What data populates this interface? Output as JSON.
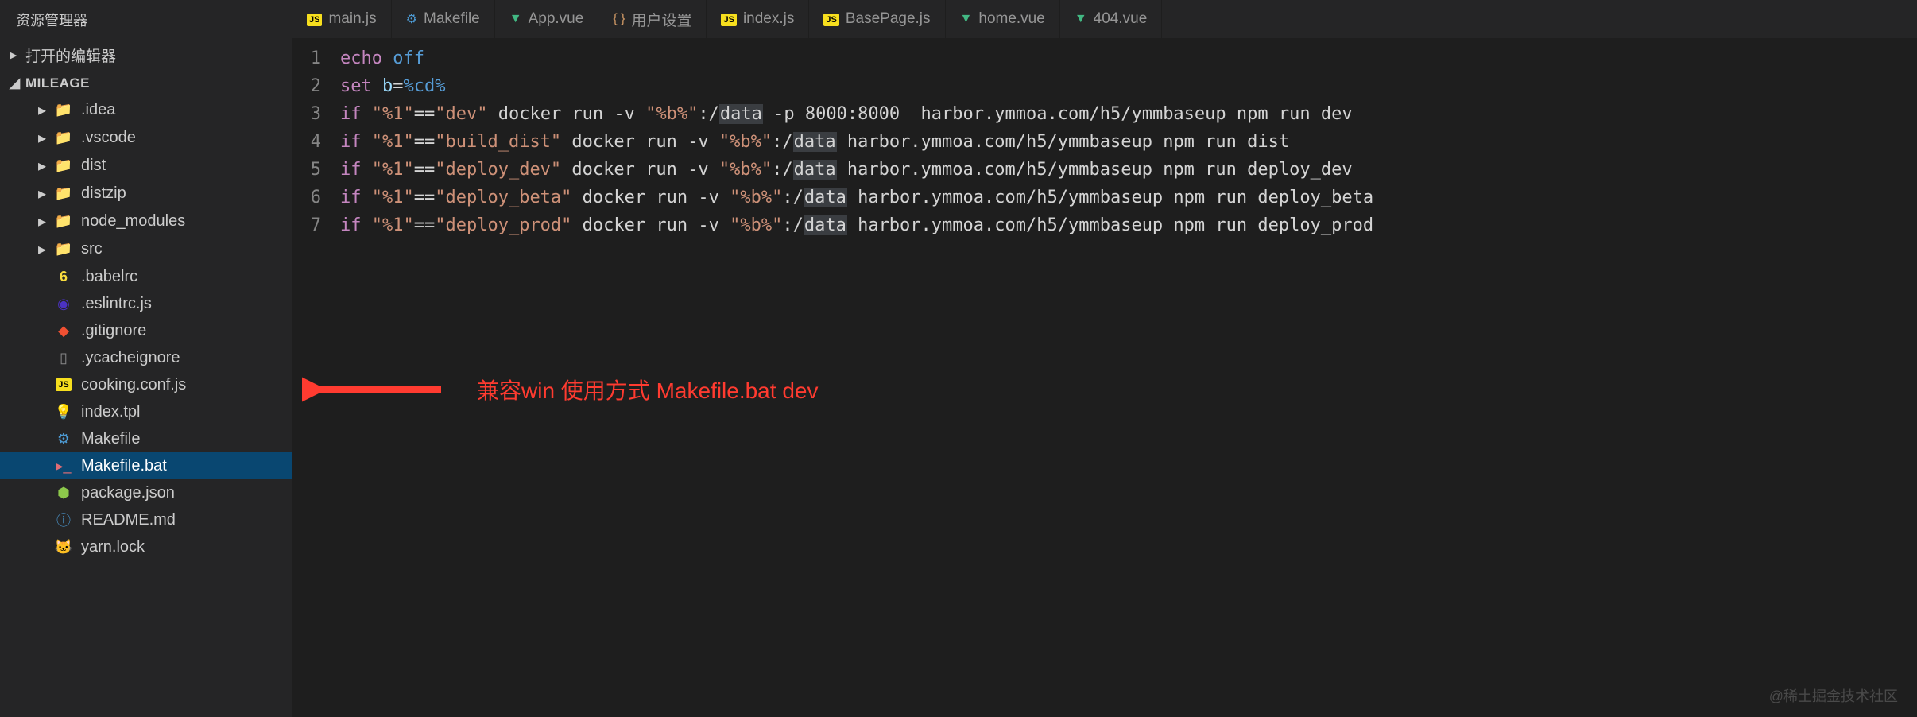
{
  "sidebar": {
    "title": "资源管理器",
    "sections": [
      {
        "label": "打开的编辑器",
        "expanded": false
      },
      {
        "label": "MILEAGE",
        "expanded": true
      }
    ],
    "tree": [
      {
        "label": ".idea",
        "icon": "folder",
        "kind": "folder"
      },
      {
        "label": ".vscode",
        "icon": "folder-blue",
        "kind": "folder"
      },
      {
        "label": "dist",
        "icon": "folder-pink",
        "kind": "folder"
      },
      {
        "label": "distzip",
        "icon": "folder",
        "kind": "folder"
      },
      {
        "label": "node_modules",
        "icon": "folder-green",
        "kind": "folder"
      },
      {
        "label": "src",
        "icon": "folder-green",
        "kind": "folder"
      },
      {
        "label": ".babelrc",
        "icon": "babel",
        "kind": "file"
      },
      {
        "label": ".eslintrc.js",
        "icon": "eslint",
        "kind": "file"
      },
      {
        "label": ".gitignore",
        "icon": "git",
        "kind": "file"
      },
      {
        "label": ".ycacheignore",
        "icon": "file",
        "kind": "file"
      },
      {
        "label": "cooking.conf.js",
        "icon": "js",
        "kind": "file"
      },
      {
        "label": "index.tpl",
        "icon": "bulb",
        "kind": "file"
      },
      {
        "label": "Makefile",
        "icon": "gear",
        "kind": "file"
      },
      {
        "label": "Makefile.bat",
        "icon": "bat",
        "kind": "file",
        "selected": true
      },
      {
        "label": "package.json",
        "icon": "node",
        "kind": "file"
      },
      {
        "label": "README.md",
        "icon": "info",
        "kind": "file"
      },
      {
        "label": "yarn.lock",
        "icon": "yarn",
        "kind": "file"
      }
    ]
  },
  "tabs": [
    {
      "label": "main.js",
      "icon": "js"
    },
    {
      "label": "Makefile",
      "icon": "gear"
    },
    {
      "label": "App.vue",
      "icon": "vue"
    },
    {
      "label": "用户设置",
      "icon": "brace"
    },
    {
      "label": "index.js",
      "icon": "js"
    },
    {
      "label": "BasePage.js",
      "icon": "js"
    },
    {
      "label": "home.vue",
      "icon": "vue"
    },
    {
      "label": "404.vue",
      "icon": "vue"
    }
  ],
  "code": {
    "lines": [
      1,
      2,
      3,
      4,
      5,
      6,
      7
    ],
    "l1_kw": "echo",
    "l1_fn": "off",
    "l2_kw": "set ",
    "l2_var": "b",
    "l2_op": "=",
    "l2_fn": "%cd%",
    "l3_kw": "if",
    "l3_s1": "\"%1\"",
    "l3_op": "==",
    "l3_s2": "\"dev\"",
    "l3_rest": " docker run -v ",
    "l3_s3": "\"%b%\"",
    "l3_colon": ":/",
    "l3_hl": "data",
    "l3_tail": " -p 8000:8000  harbor.ymmoa.com/h5/ymmbaseup npm run dev",
    "l4_kw": "if",
    "l4_s1": "\"%1\"",
    "l4_op": "==",
    "l4_s2": "\"build_dist\"",
    "l4_rest": " docker run -v ",
    "l4_s3": "\"%b%\"",
    "l4_colon": ":/",
    "l4_hl": "data",
    "l4_tail": " harbor.ymmoa.com/h5/ymmbaseup npm run dist",
    "l5_kw": "if",
    "l5_s1": "\"%1\"",
    "l5_op": "==",
    "l5_s2": "\"deploy_dev\"",
    "l5_rest": " docker run -v ",
    "l5_s3": "\"%b%\"",
    "l5_colon": ":/",
    "l5_hl": "data",
    "l5_tail": " harbor.ymmoa.com/h5/ymmbaseup npm run deploy_dev",
    "l6_kw": "if",
    "l6_s1": "\"%1\"",
    "l6_op": "==",
    "l6_s2": "\"deploy_beta\"",
    "l6_rest": " docker run -v ",
    "l6_s3": "\"%b%\"",
    "l6_colon": ":/",
    "l6_hl": "data",
    "l6_tail": " harbor.ymmoa.com/h5/ymmbaseup npm run deploy_beta",
    "l7_kw": "if",
    "l7_s1": "\"%1\"",
    "l7_op": "==",
    "l7_s2": "\"deploy_prod\"",
    "l7_rest": " docker run -v ",
    "l7_s3": "\"%b%\"",
    "l7_colon": ":/",
    "l7_hl": "data",
    "l7_tail": " harbor.ymmoa.com/h5/ymmbaseup npm run deploy_prod"
  },
  "annotation": "兼容win  使用方式   Makefile.bat dev",
  "watermark": "@稀土掘金技术社区"
}
